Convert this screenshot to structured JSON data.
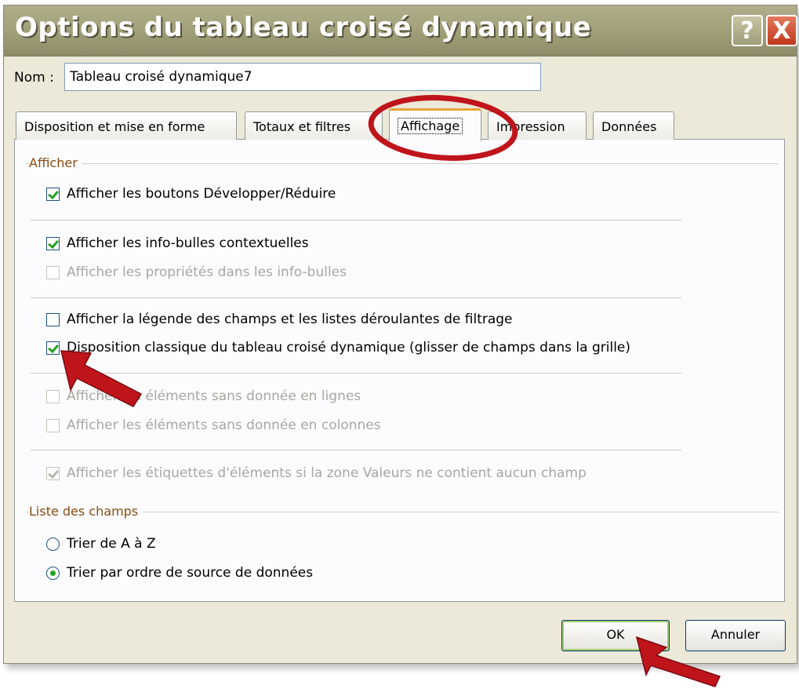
{
  "window": {
    "title": "Options du tableau croisé dynamique",
    "help_glyph": "?",
    "close_glyph": "X"
  },
  "name_field": {
    "label": "Nom :",
    "value": "Tableau croisé dynamique7"
  },
  "tabs": [
    {
      "label": "Disposition et mise en forme",
      "active": false
    },
    {
      "label": "Totaux et filtres",
      "active": false
    },
    {
      "label": "Affichage",
      "active": true
    },
    {
      "label": "Impression",
      "active": false
    },
    {
      "label": "Données",
      "active": false
    }
  ],
  "display_group": {
    "label": "Afficher",
    "options": [
      {
        "label": "Afficher les boutons Développer/Réduire",
        "checked": true,
        "enabled": true
      },
      {
        "label": "Afficher les info-bulles contextuelles",
        "checked": true,
        "enabled": true
      },
      {
        "label": "Afficher les propriétés dans les info-bulles",
        "checked": false,
        "enabled": false
      },
      {
        "label": "Afficher la légende des champs et les listes déroulantes de filtrage",
        "checked": false,
        "enabled": true
      },
      {
        "label": "Disposition classique du tableau croisé dynamique (glisser de champs dans la grille)",
        "checked": true,
        "enabled": true
      },
      {
        "label": "Afficher les éléments sans donnée en lignes",
        "checked": false,
        "enabled": false
      },
      {
        "label": "Afficher les éléments sans donnée en colonnes",
        "checked": false,
        "enabled": false
      },
      {
        "label": "Afficher les étiquettes d'éléments si la zone Valeurs ne contient aucun champ",
        "checked": true,
        "enabled": false
      }
    ]
  },
  "field_list_group": {
    "label": "Liste des champs",
    "options": [
      {
        "label": "Trier de A à Z",
        "selected": false
      },
      {
        "label": "Trier par ordre de source de données",
        "selected": true
      }
    ]
  },
  "buttons": {
    "ok": "OK",
    "cancel": "Annuler"
  },
  "colors": {
    "title_bar": "#a4a27c",
    "group_label": "#8a4b0f",
    "annotation": "#c0141b",
    "checkmark": "#21a121"
  }
}
